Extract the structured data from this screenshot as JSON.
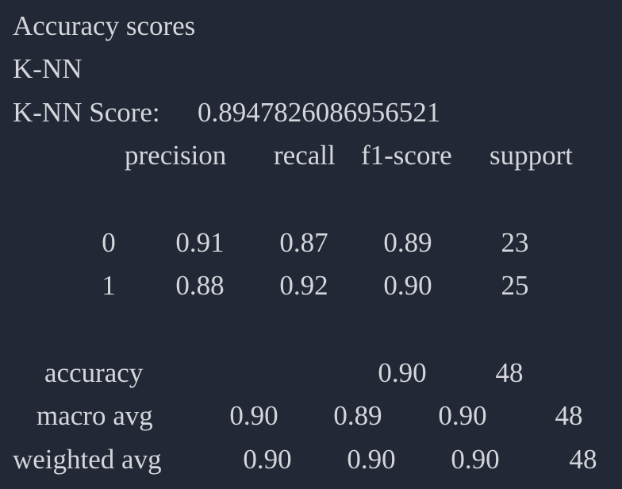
{
  "output": {
    "heading": "Accuracy scores",
    "model_name": "K-NN",
    "score_label": "K-NN Score:",
    "score_value": "0.8947826086956521",
    "report": {
      "columns": [
        "precision",
        "recall",
        "f1-score",
        "support"
      ],
      "rows": [
        {
          "label": "0",
          "precision": "0.91",
          "recall": "0.87",
          "f1": "0.89",
          "support": "23"
        },
        {
          "label": "1",
          "precision": "0.88",
          "recall": "0.92",
          "f1": "0.90",
          "support": "25"
        }
      ],
      "accuracy": {
        "label": "accuracy",
        "f1": "0.90",
        "support": "48"
      },
      "macro_avg": {
        "label": "macro avg",
        "precision": "0.90",
        "recall": "0.89",
        "f1": "0.90",
        "support": "48"
      },
      "weighted_avg": {
        "label": "weighted avg",
        "precision": "0.90",
        "recall": "0.90",
        "f1": "0.90",
        "support": "48"
      }
    }
  }
}
